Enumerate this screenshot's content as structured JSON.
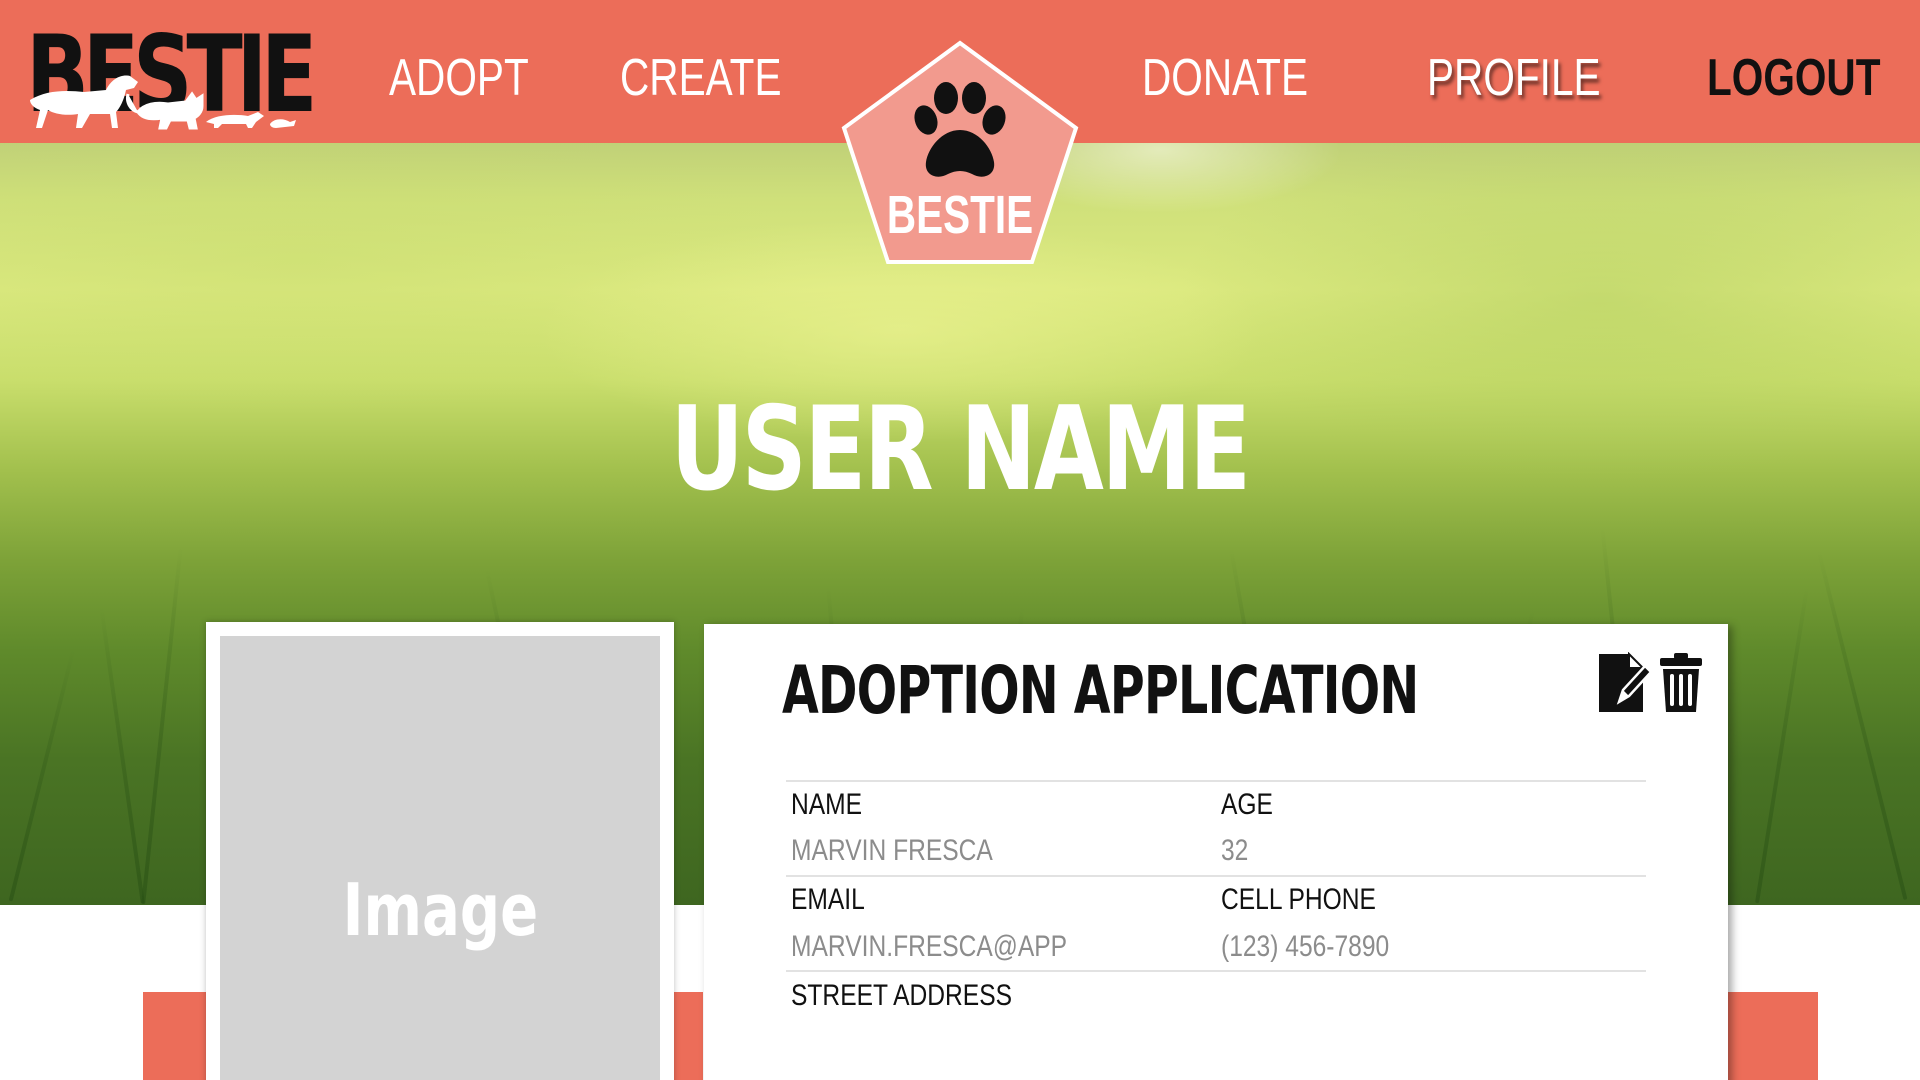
{
  "brand": {
    "logo_text": "BESTIE",
    "badge_text": "BESTIE",
    "colors": {
      "accent": "#ec6d59",
      "badge_fill": "#f29a8e",
      "ink": "#111111"
    }
  },
  "nav": {
    "adopt": "ADOPT",
    "create": "CREATE",
    "donate": "DONATE",
    "profile": "PROFILE",
    "logout": "LOGOUT"
  },
  "hero": {
    "username": "USER NAME"
  },
  "image_card": {
    "label": "Image"
  },
  "application": {
    "title": "ADOPTION APPLICATION",
    "actions": {
      "edit_icon": "edit-document-icon",
      "delete_icon": "trash-icon"
    },
    "fields": [
      {
        "label": "NAME",
        "value": "MARVIN FRESCA"
      },
      {
        "label": "AGE",
        "value": "32"
      },
      {
        "label": "EMAIL",
        "value": "MARVIN.FRESCA@APP"
      },
      {
        "label": "CELL PHONE",
        "value": "(123) 456-7890"
      },
      {
        "label": "STREET ADDRESS",
        "value": ""
      }
    ]
  }
}
